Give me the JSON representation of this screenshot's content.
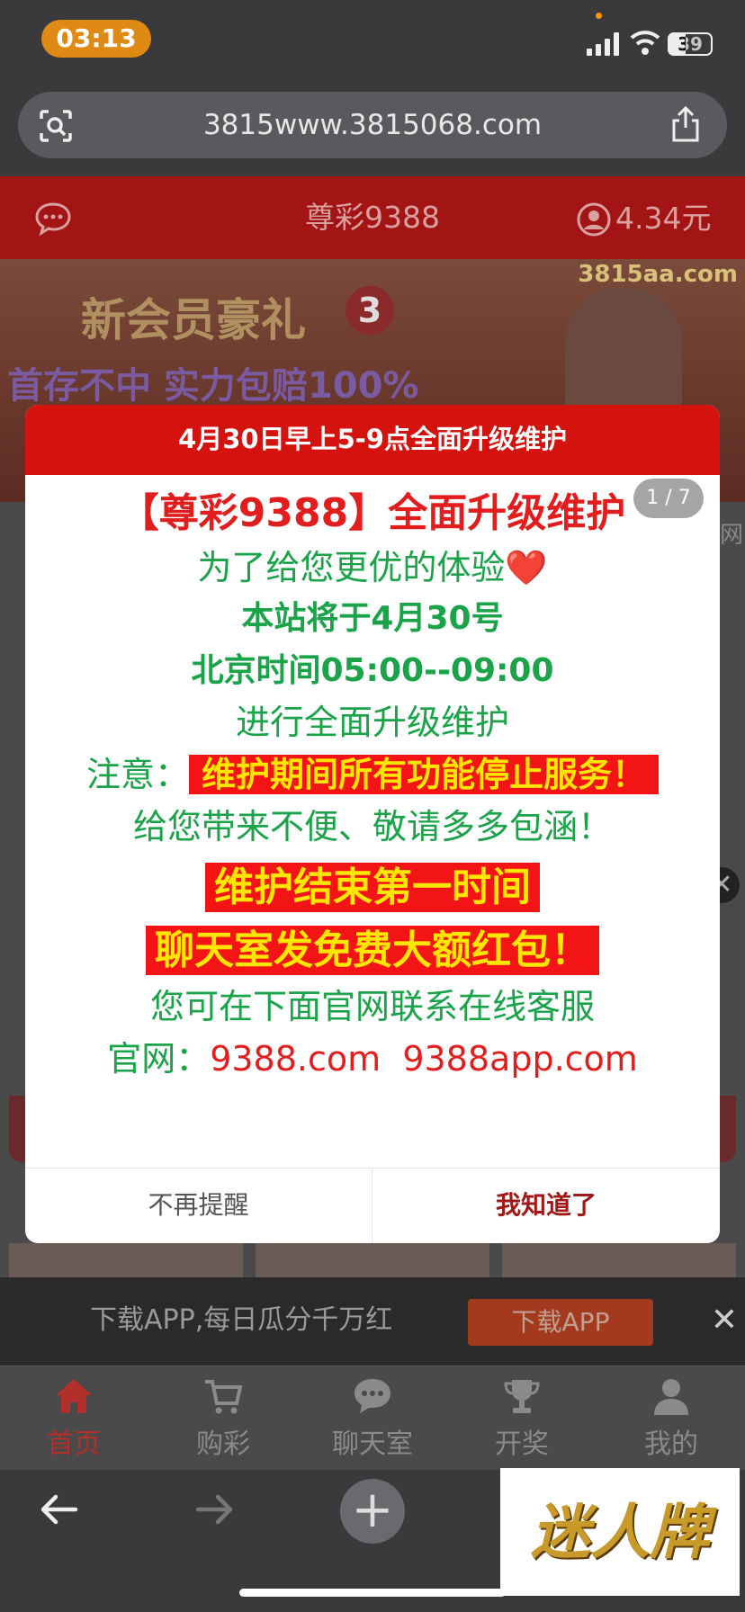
{
  "status_bar": {
    "time": "03:13",
    "battery": "39"
  },
  "browser": {
    "url": "3815www.3815068.com"
  },
  "site_header": {
    "title": "尊彩9388",
    "balance": "4.34元"
  },
  "banner": {
    "domain": "3815aa.com",
    "headline": "新会员豪礼",
    "badge": "3",
    "subline": "首存不中 实力包赔100%"
  },
  "page_behind": {
    "partial_text": "网"
  },
  "modal": {
    "header": "4月30日早上5-9点全面升级维护",
    "page_indicator": "1 / 7",
    "lines": {
      "title": "【尊彩9388】全面升级维护",
      "l2": "为了给您更优的体验❤️",
      "l3": "本站将于4月30号",
      "l4": "北京时间05:00--09:00",
      "l5": "进行全面升级维护",
      "l6_prefix": "注意：",
      "l6_highlight": "维护期间所有功能停止服务！",
      "l7": "给您带来不便、敬请多多包涵！",
      "l8_highlight": "维护结束第一时间",
      "l9_highlight": "聊天室发免费大额红包！",
      "l10": "您可在下面官网联系在线客服",
      "l11_prefix": "官网：",
      "l11_link1": "9388.com",
      "l11_link2": "9388app.com"
    },
    "dismiss_label": "不再提醒",
    "ok_label": "我知道了"
  },
  "download_strip": {
    "text": "下载APP,每日瓜分千万红",
    "button": "下载APP",
    "close": "✕"
  },
  "tabbar": {
    "items": [
      {
        "label": "首页",
        "icon": "home-icon"
      },
      {
        "label": "购彩",
        "icon": "cart-icon"
      },
      {
        "label": "聊天室",
        "icon": "chat-bubble-icon"
      },
      {
        "label": "开奖",
        "icon": "trophy-icon"
      },
      {
        "label": "我的",
        "icon": "person-icon"
      }
    ],
    "active_color": "#b3302a"
  },
  "toolbar": {
    "plus": "+"
  },
  "watermark": {
    "text": "迷人牌"
  },
  "colors": {
    "modal_red": "#d4130f",
    "green_text": "#1ba34a",
    "red_text": "#e11d1d",
    "highlight_yellow": "#ffe600"
  }
}
